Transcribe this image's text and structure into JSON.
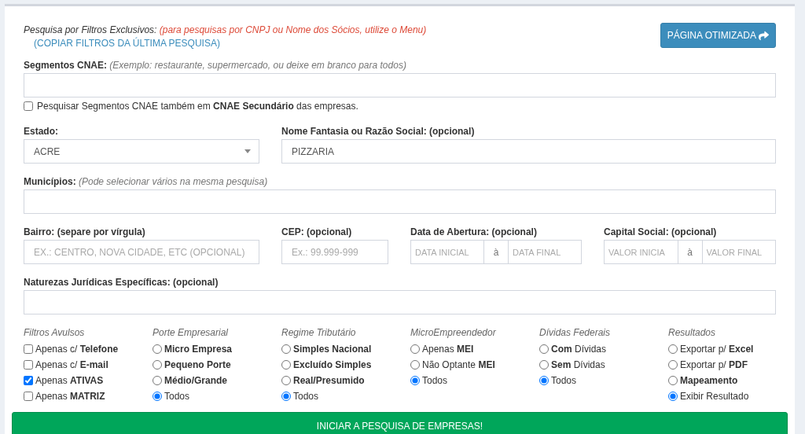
{
  "header": {
    "title": "Pesquisa por Filtros Exclusivos:",
    "note": "(para pesquisas por CNPJ ou Nome dos Sócios, utilize o Menu)",
    "copy_link": "(COPIAR FILTROS DA ÚLTIMA PESQUISA)",
    "optimized_button": "PÁGINA OTIMIZADA"
  },
  "cnae": {
    "label": "Segmentos CNAE:",
    "hint": "(Exemplo: restaurante, supermercado, ou deixe em branco para todos)",
    "secondary": {
      "label": "Pesquisar Segmentos CNAE também em **CNAE Secundário** das empresas.",
      "checked": false
    }
  },
  "estado": {
    "label": "Estado:",
    "value": "ACRE"
  },
  "nome": {
    "label": "Nome Fantasia ou Razão Social: (opcional)",
    "value": "PIZZARIA"
  },
  "municipios": {
    "label": "Municípios:",
    "hint": "(Pode selecionar vários na mesma pesquisa)"
  },
  "bairro": {
    "label": "Bairro: (separe por vírgula)",
    "placeholder": "EX.: CENTRO, NOVA CIDADE, ETC (OPCIONAL)"
  },
  "cep": {
    "label": "CEP: (opcional)",
    "placeholder": "Ex.: 99.999-999"
  },
  "ranges": [
    {
      "label": "Data de Abertura: (opcional)",
      "from_placeholder": "DATA INICIAL",
      "separator": "à",
      "to_placeholder": "DATA FINAL"
    },
    {
      "label": "Capital Social: (opcional)",
      "from_placeholder": "VALOR INICIA",
      "separator": "à",
      "to_placeholder": "VALOR FINAL"
    }
  ],
  "naturezas": {
    "label": "Naturezas Jurídicas Específicas: (opcional)"
  },
  "filter_groups": [
    {
      "title": "Filtros Avulsos",
      "kind": "checkbox",
      "options": [
        {
          "label": "Apenas c/ **Telefone**",
          "checked": false
        },
        {
          "label": "Apenas c/ **E-mail**",
          "checked": false
        },
        {
          "label": "Apenas **ATIVAS**",
          "checked": true
        },
        {
          "label": "Apenas **MATRIZ**",
          "checked": false
        }
      ]
    },
    {
      "title": "Porte Empresarial",
      "kind": "radio",
      "options": [
        {
          "label": "Micro Empresa",
          "emphasis": true,
          "selected": false
        },
        {
          "label": "Pequeno Porte",
          "emphasis": true,
          "selected": false
        },
        {
          "label": "Médio/Grande",
          "emphasis": true,
          "selected": false
        },
        {
          "label": "Todos",
          "emphasis": false,
          "selected": true
        }
      ]
    },
    {
      "title": "Regime Tributário",
      "kind": "radio",
      "options": [
        {
          "label": "Simples Nacional",
          "emphasis": true,
          "selected": false
        },
        {
          "label": "Excluído Simples",
          "emphasis": true,
          "selected": false
        },
        {
          "label": "Real/Presumido",
          "emphasis": true,
          "selected": false
        },
        {
          "label": "Todos",
          "emphasis": false,
          "selected": true
        }
      ]
    },
    {
      "title": "MicroEmpreendedor",
      "kind": "radio",
      "options": [
        {
          "label": "Apenas **MEI**",
          "emphasis": false,
          "selected": false
        },
        {
          "label": "Não Optante **MEI**",
          "emphasis": false,
          "selected": false
        },
        {
          "label": "Todos",
          "emphasis": false,
          "selected": true
        }
      ]
    },
    {
      "title": "Dívidas Federais",
      "kind": "radio",
      "options": [
        {
          "label": "**Com** Dívidas",
          "emphasis": false,
          "selected": false
        },
        {
          "label": "**Sem** Dívidas",
          "emphasis": false,
          "selected": false
        },
        {
          "label": "Todos",
          "emphasis": false,
          "selected": true
        }
      ]
    },
    {
      "title": "Resultados",
      "kind": "radio",
      "options": [
        {
          "label": "Exportar p/ **Excel**",
          "emphasis": false,
          "selected": false
        },
        {
          "label": "Exportar p/ **PDF**",
          "emphasis": false,
          "selected": false
        },
        {
          "label": "Mapeamento",
          "emphasis": true,
          "selected": false
        },
        {
          "label": "Exibir Resultado",
          "emphasis": false,
          "selected": true
        }
      ]
    }
  ],
  "submit_button": "INICIAR A PESQUISA DE EMPRESAS!"
}
